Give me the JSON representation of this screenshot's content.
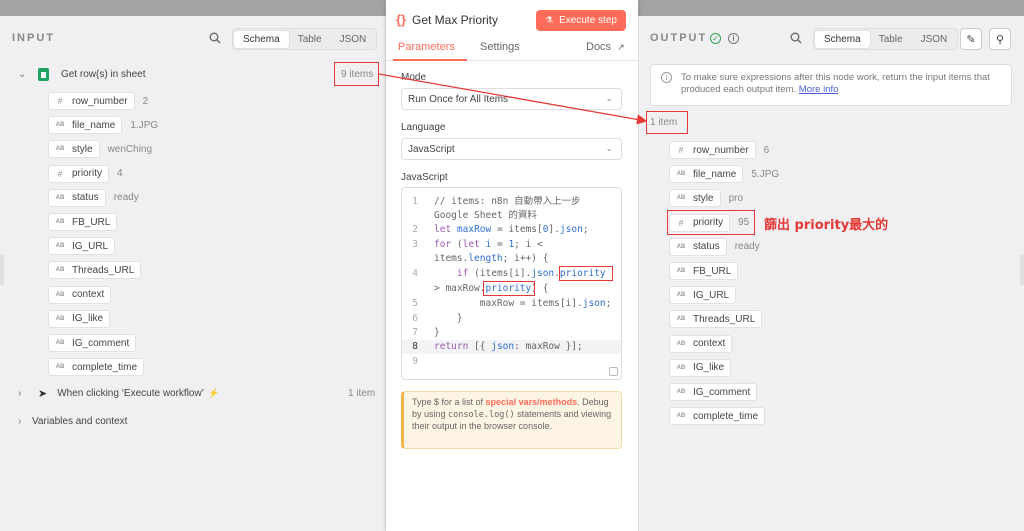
{
  "input": {
    "header": "INPUT",
    "tabs": [
      "Schema",
      "Table",
      "JSON"
    ],
    "node": {
      "label": "Get row(s) in sheet",
      "count": "9 items"
    },
    "fields": [
      {
        "type": "#",
        "name": "row_number",
        "value": "2"
      },
      {
        "type": "AB",
        "name": "file_name",
        "value": "1.JPG"
      },
      {
        "type": "AB",
        "name": "style",
        "value": "wenChing"
      },
      {
        "type": "#",
        "name": "priority",
        "value": "4"
      },
      {
        "type": "AB",
        "name": "status",
        "value": "ready"
      },
      {
        "type": "AB",
        "name": "FB_URL",
        "value": ""
      },
      {
        "type": "AB",
        "name": "IG_URL",
        "value": ""
      },
      {
        "type": "AB",
        "name": "Threads_URL",
        "value": ""
      },
      {
        "type": "AB",
        "name": "context",
        "value": ""
      },
      {
        "type": "AB",
        "name": "IG_like",
        "value": ""
      },
      {
        "type": "AB",
        "name": "IG_comment",
        "value": ""
      },
      {
        "type": "AB",
        "name": "complete_time",
        "value": ""
      }
    ],
    "trigger": {
      "label": "When clicking ‘Execute workflow’",
      "count": "1 item"
    },
    "variables": "Variables and context"
  },
  "center": {
    "title": "Get Max Priority",
    "execute": "Execute step",
    "tabs": {
      "parameters": "Parameters",
      "settings": "Settings",
      "docs": "Docs"
    },
    "mode_label": "Mode",
    "mode_value": "Run Once for All Items",
    "language_label": "Language",
    "language_value": "JavaScript",
    "code_label": "JavaScript",
    "hint": {
      "pre": "Type $ for a list of ",
      "link": "special vars/methods",
      "mid": ". Debug by using ",
      "code": "console.log()",
      "post": " statements and viewing their output in the browser console."
    }
  },
  "output": {
    "header": "OUTPUT",
    "tabs": [
      "Schema",
      "Table",
      "JSON"
    ],
    "notice": "To make sure expressions after this node work, return the input items that produced each output item.",
    "notice_link": "More info",
    "count": "1 item",
    "fields": [
      {
        "type": "#",
        "name": "row_number",
        "value": "6"
      },
      {
        "type": "AB",
        "name": "file_name",
        "value": "5.JPG"
      },
      {
        "type": "AB",
        "name": "style",
        "value": "pro"
      },
      {
        "type": "#",
        "name": "priority",
        "value": "95"
      },
      {
        "type": "AB",
        "name": "status",
        "value": "ready"
      },
      {
        "type": "AB",
        "name": "FB_URL",
        "value": ""
      },
      {
        "type": "AB",
        "name": "IG_URL",
        "value": ""
      },
      {
        "type": "AB",
        "name": "Threads_URL",
        "value": ""
      },
      {
        "type": "AB",
        "name": "context",
        "value": ""
      },
      {
        "type": "AB",
        "name": "IG_like",
        "value": ""
      },
      {
        "type": "AB",
        "name": "IG_comment",
        "value": ""
      },
      {
        "type": "AB",
        "name": "complete_time",
        "value": ""
      }
    ]
  },
  "annotation": "篩出 priority最大的",
  "colors": {
    "accent": "#ff6d5a",
    "annotation_red": "#e53935",
    "success": "#2ea44f"
  }
}
